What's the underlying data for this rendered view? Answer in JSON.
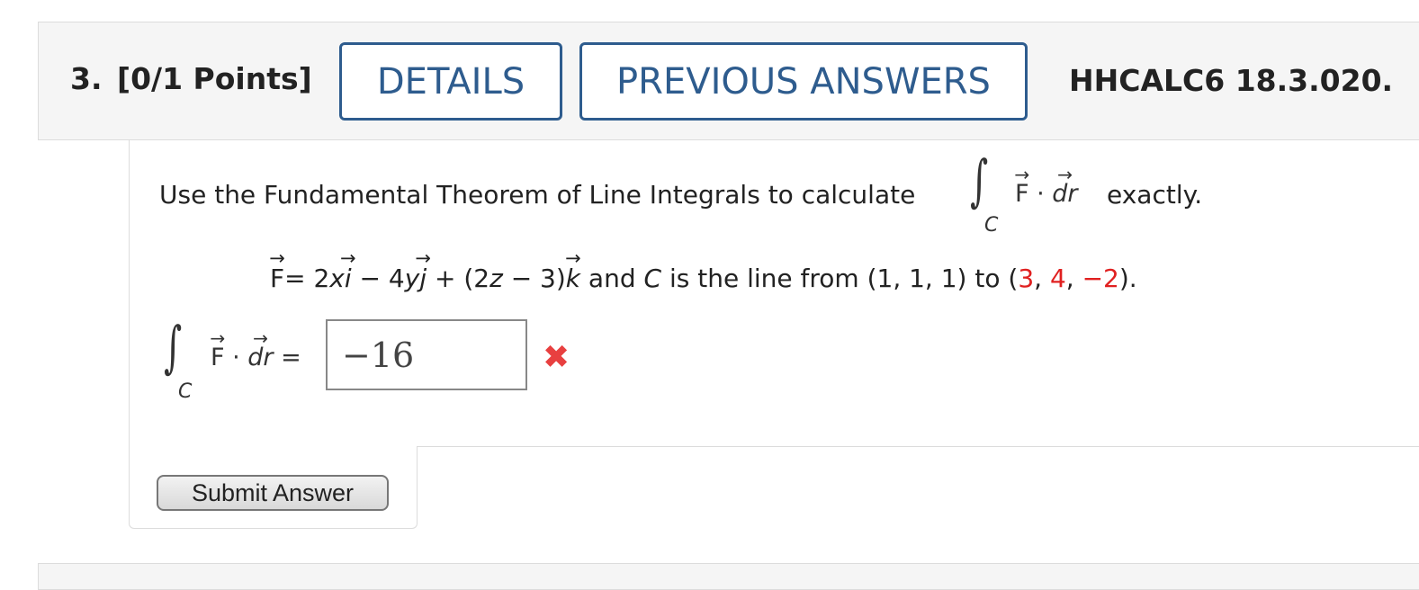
{
  "question": {
    "number": "3.",
    "points": "[0/1 Points]",
    "details_label": "DETAILS",
    "previous_answers_label": "PREVIOUS ANSWERS",
    "reference": "HHCALC6 18.3.020."
  },
  "problem": {
    "prompt_text": "Use the Fundamental Theorem of Line Integrals to calculate",
    "prompt_suffix": "exactly.",
    "integral_subscript": "C",
    "field_F": "F",
    "field_dr": "dr",
    "eq_eq": "= 2",
    "eq_x": "x",
    "eq_i": "i",
    "eq_minus4": " − 4",
    "eq_y": "y",
    "eq_j": "j",
    "eq_plus": " + (2",
    "eq_z": "z",
    "eq_minus3": " − 3)",
    "eq_k": "k",
    "eq_and": "  and ",
    "eq_C": "C",
    "eq_line_from": " is the line from  (1, 1, 1)  to  (",
    "endpoint": [
      "3",
      "4",
      "−2"
    ],
    "eq_close": ")."
  },
  "answer": {
    "equals": "=",
    "value": "−16",
    "status": "incorrect"
  },
  "submit": {
    "label": "Submit Answer"
  },
  "colors": {
    "accent": "#2e5c8e",
    "error": "#e84040",
    "highlight_red": "#e02020"
  },
  "icons": {
    "incorrect": "x-mark-icon"
  }
}
